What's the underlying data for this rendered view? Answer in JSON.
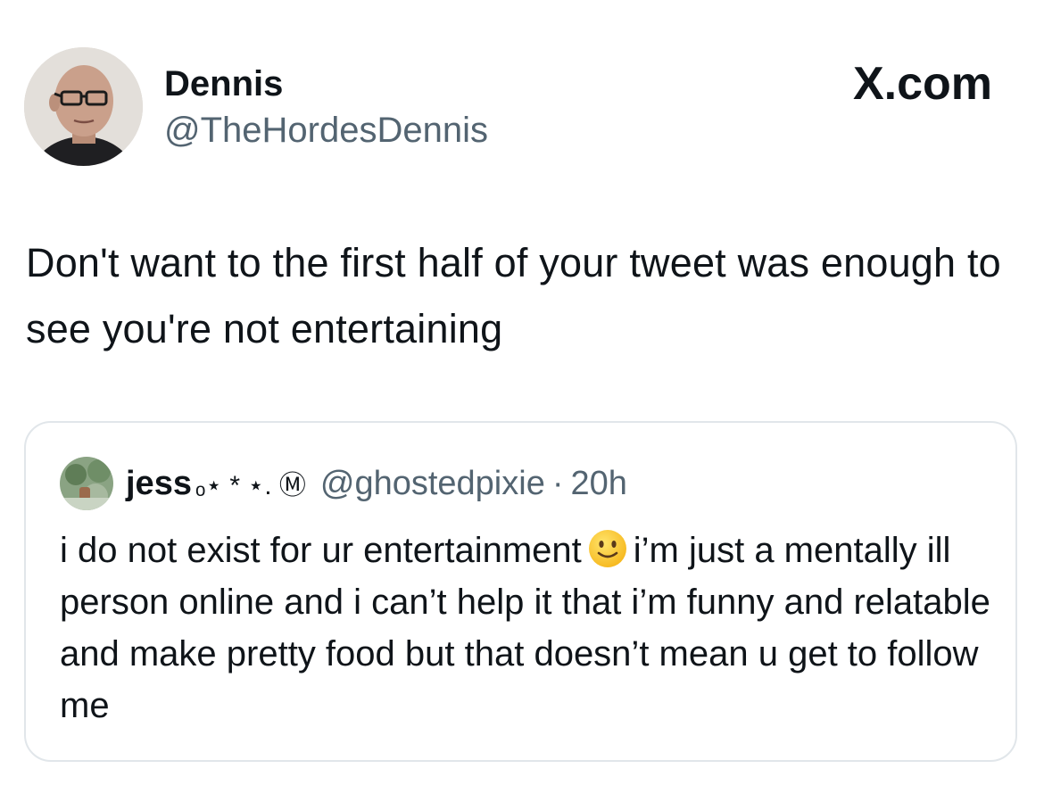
{
  "author": {
    "display_name": "Dennis",
    "handle": "@TheHordesDennis",
    "avatar_icon": "profile-photo"
  },
  "brand": {
    "logo_text": "X.com"
  },
  "tweet": {
    "text": "Don't want to the first half of your tweet was enough to see you're not entertaining"
  },
  "quoted_tweet": {
    "display_name": "jess",
    "name_decoration": "ₒ⋆ * ⋆. Ⓜ",
    "handle": "@ghostedpixie",
    "separator": "·",
    "time": "20h",
    "text_part1": "i do not exist for ur entertainment",
    "emoji_icon": "slightly-smiling-face-icon",
    "text_part2": "i’m just a mentally ill person online and i can’t help it that i’m funny and relatable and make pretty food but that doesn’t mean u get to follow me"
  },
  "colors": {
    "text_primary": "#0f1419",
    "text_secondary": "#536471",
    "card_border": "#e1e6ea"
  }
}
